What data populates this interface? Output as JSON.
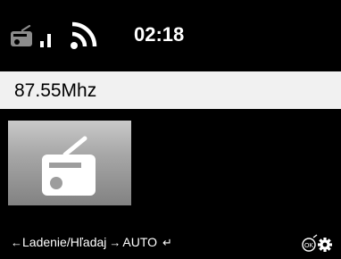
{
  "status_bar": {
    "time": "02:18",
    "icons": [
      "radio-mini-icon",
      "signal-icon",
      "wifi-icon"
    ]
  },
  "station": {
    "frequency": "87.55Mhz"
  },
  "artwork": {
    "icon": "radio-icon"
  },
  "footer": {
    "hint_left_arrow": "←",
    "hint_label": "Ladenie/Hľadaj",
    "hint_right_arrow": "→",
    "hint_mode": "AUTO",
    "hint_enter": "↵",
    "icons": [
      "ok-icon",
      "gear-icon"
    ]
  },
  "colors": {
    "background": "#000000",
    "frequency_bar": "#f1f1f1",
    "text": "#ffffff"
  }
}
